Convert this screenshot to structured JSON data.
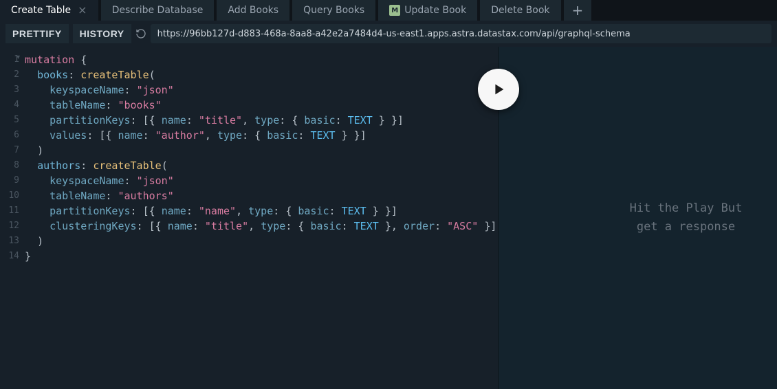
{
  "tabs": [
    {
      "label": "Create Table",
      "active": true,
      "closeable": true
    },
    {
      "label": "Describe Database",
      "active": false,
      "closeable": false
    },
    {
      "label": "Add Books",
      "active": false,
      "closeable": false
    },
    {
      "label": "Query Books",
      "active": false,
      "closeable": false
    },
    {
      "label": "Update Book",
      "active": false,
      "closeable": false,
      "badge": "M"
    },
    {
      "label": "Delete Book",
      "active": false,
      "closeable": false
    }
  ],
  "toolbar": {
    "prettify": "PRETTIFY",
    "history": "HISTORY"
  },
  "url": "https://96bb127d-d883-468a-8aa8-a42e2a7484d4-us-east1.apps.astra.datastax.com/api/graphql-schema",
  "code": {
    "lines": [
      "1",
      "2",
      "3",
      "4",
      "5",
      "6",
      "7",
      "8",
      "9",
      "10",
      "11",
      "12",
      "13",
      "14"
    ],
    "raw": "mutation {\n  books: createTable(\n    keyspaceName: \"json\"\n    tableName: \"books\"\n    partitionKeys: [{ name: \"title\", type: { basic: TEXT } }]\n    values: [{ name: \"author\", type: { basic: TEXT } }]\n  )\n  authors: createTable(\n    keyspaceName: \"json\"\n    tableName: \"authors\"\n    partitionKeys: [{ name: \"name\", type: { basic: TEXT } }]\n    clusteringKeys: [{ name: \"title\", type: { basic: TEXT }, order: \"ASC\" }]\n  )\n}"
  },
  "result_hint": "Hit the Play But\nget a response"
}
